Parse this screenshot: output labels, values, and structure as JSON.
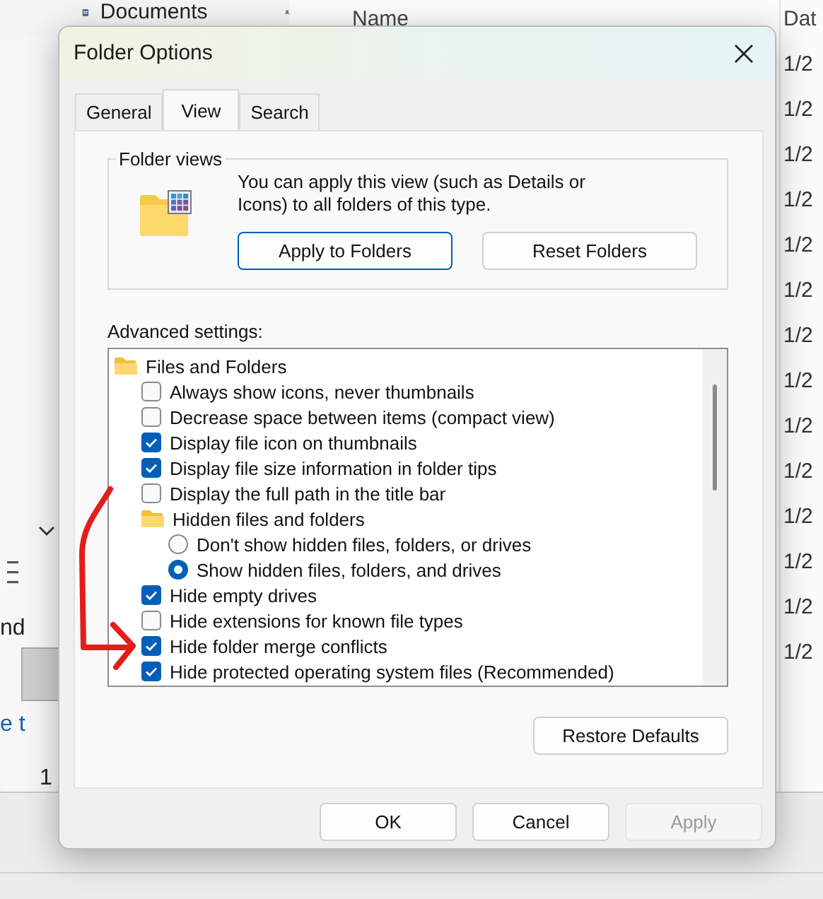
{
  "explorer": {
    "nav_item": "Documents",
    "column_1": "Name",
    "column_2": "Dat",
    "dates": [
      "1/2",
      "1/2",
      "1/2",
      "1/2",
      "1/2",
      "1/2",
      "1/2",
      "1/2",
      "1/2",
      "1/2",
      "1/2",
      "1/2",
      "1/2",
      "1/2"
    ],
    "left_texts": [
      "nd",
      "e t",
      "1"
    ]
  },
  "dialog": {
    "title": "Folder Options",
    "tabs": [
      {
        "label": "General",
        "selected": false
      },
      {
        "label": "View",
        "selected": true
      },
      {
        "label": "Search",
        "selected": false
      }
    ],
    "folder_views": {
      "legend": "Folder views",
      "text": "You can apply this view (such as Details or Icons) to all folders of this type.",
      "buttons": [
        {
          "label": "Apply to Folders",
          "default": true
        },
        {
          "label": "Reset Folders",
          "default": false
        }
      ]
    },
    "advanced": {
      "label": "Advanced settings:",
      "items": [
        {
          "kind": "folder",
          "label": "Files and Folders",
          "children": [
            {
              "kind": "checkbox",
              "label": "Always show icons, never thumbnails",
              "checked": false
            },
            {
              "kind": "checkbox",
              "label": "Decrease space between items (compact view)",
              "checked": false
            },
            {
              "kind": "checkbox",
              "label": "Display file icon on thumbnails",
              "checked": true
            },
            {
              "kind": "checkbox",
              "label": "Display file size information in folder tips",
              "checked": true
            },
            {
              "kind": "checkbox",
              "label": "Display the full path in the title bar",
              "checked": false
            },
            {
              "kind": "folder",
              "label": "Hidden files and folders",
              "children": [
                {
                  "kind": "radio",
                  "label": "Don't show hidden files, folders, or drives",
                  "selected": false
                },
                {
                  "kind": "radio",
                  "label": "Show hidden files, folders, and drives",
                  "selected": true
                }
              ]
            },
            {
              "kind": "checkbox",
              "label": "Hide empty drives",
              "checked": true
            },
            {
              "kind": "checkbox",
              "label": "Hide extensions for known file types",
              "checked": false
            },
            {
              "kind": "checkbox",
              "label": "Hide folder merge conflicts",
              "checked": true
            },
            {
              "kind": "checkbox",
              "label": "Hide protected operating system files (Recommended)",
              "checked": true
            }
          ]
        }
      ]
    },
    "restore_button": "Restore Defaults",
    "buttons": [
      {
        "label": "OK",
        "disabled": false
      },
      {
        "label": "Cancel",
        "disabled": false
      },
      {
        "label": "Apply",
        "disabled": true
      }
    ]
  }
}
